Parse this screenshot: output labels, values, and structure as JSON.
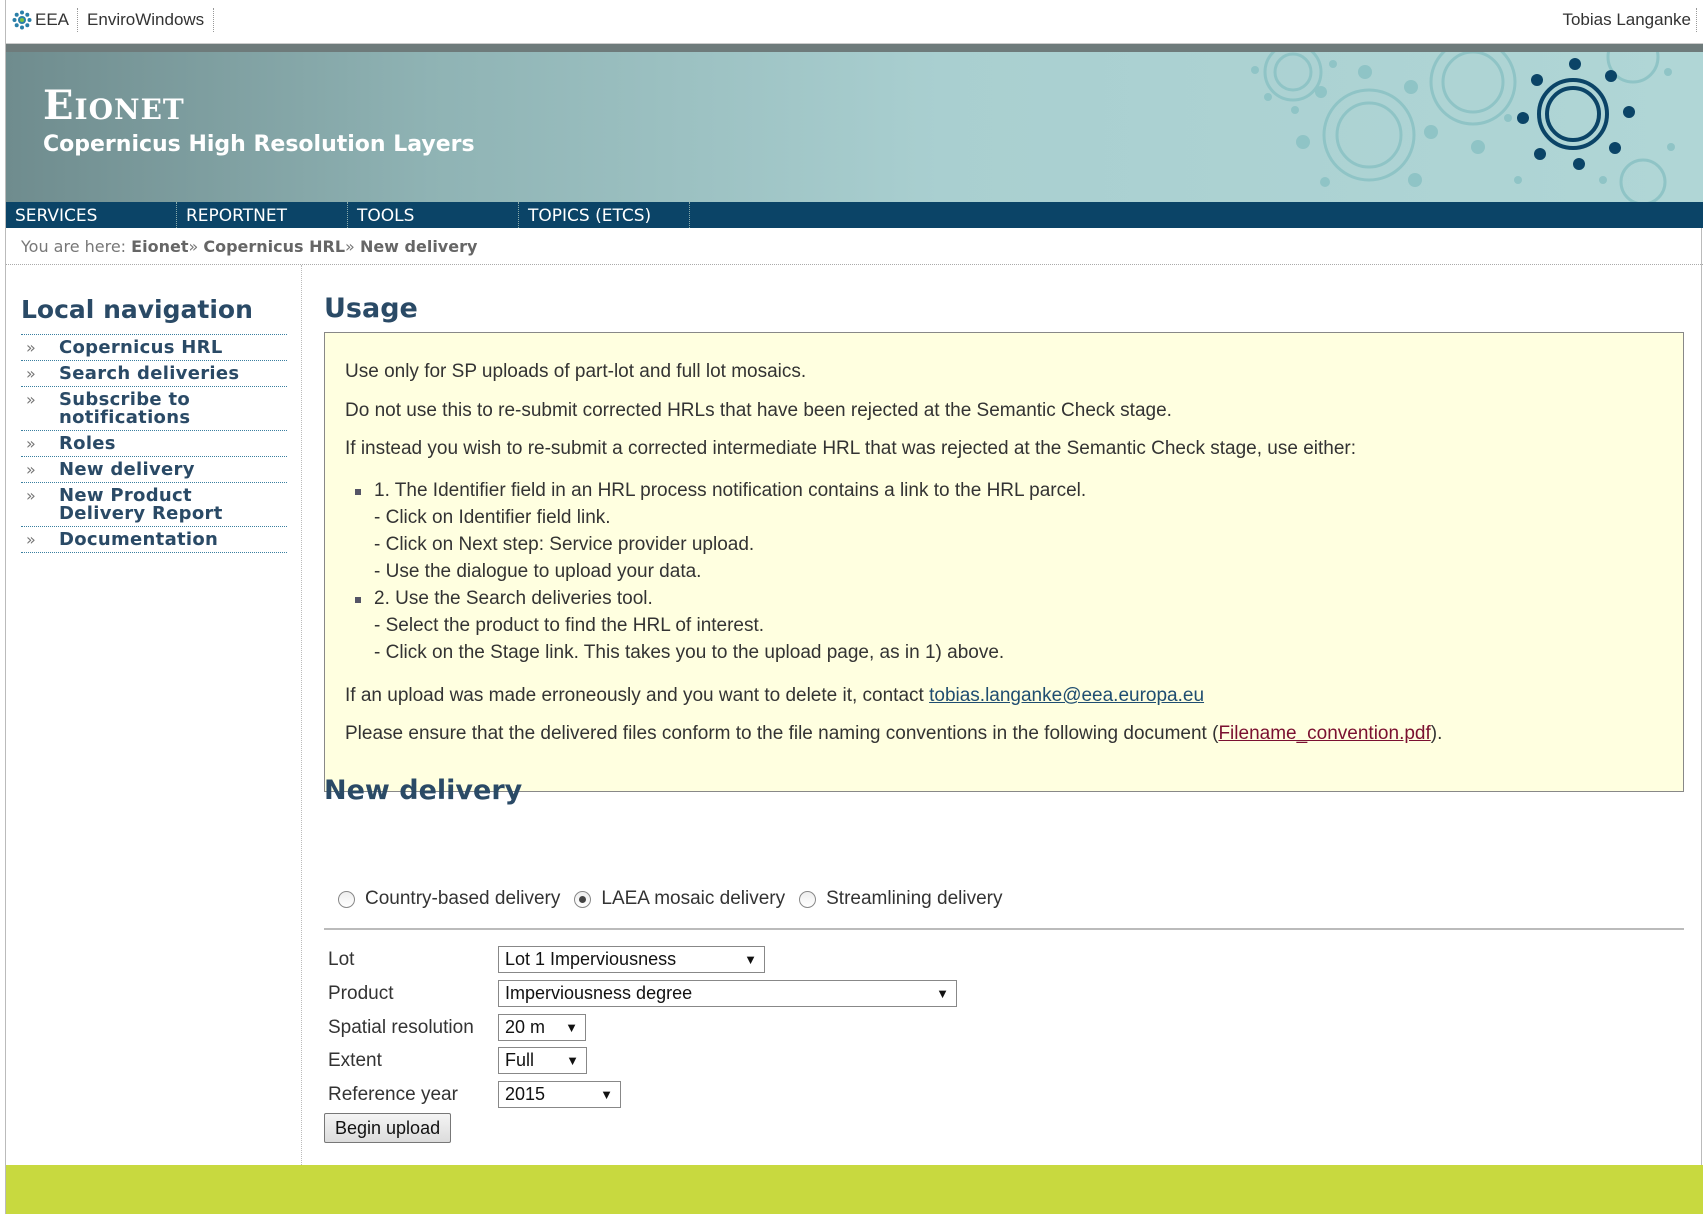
{
  "topbar": {
    "eea_label": "EEA",
    "envirowindows_label": "EnviroWindows",
    "user_name": "Tobias Langanke"
  },
  "header": {
    "site_title": "Eionet",
    "subtitle": "Copernicus High Resolution Layers"
  },
  "nav": [
    "SERVICES",
    "REPORTNET",
    "TOOLS",
    "TOPICS (ETCS)"
  ],
  "breadcrumb": {
    "prefix": "You are here:",
    "items": [
      "Eionet",
      "Copernicus HRL",
      "New delivery"
    ],
    "separator": "»"
  },
  "local_nav": {
    "title": "Local navigation",
    "items": [
      "Copernicus HRL",
      "Search deliveries",
      "Subscribe to notifications",
      "Roles",
      "New delivery",
      "New Product Delivery Report",
      "Documentation"
    ]
  },
  "usage": {
    "heading": "Usage",
    "line1": "Use only for SP uploads of part-lot and full lot mosaics.",
    "line2": "Do not use this to re-submit corrected HRLs that have been rejected at the Semantic Check stage.",
    "line3": "If instead you wish to re-submit a corrected intermediate HRL that was rejected at the Semantic Check stage, use either:",
    "item1": "1. The Identifier field in an HRL process notification contains a link to the HRL parcel.",
    "item1_steps": [
      "- Click on Identifier field link.",
      "- Click on Next step: Service provider upload.",
      "- Use the dialogue to upload your data."
    ],
    "item2": "2. Use the Search deliveries tool.",
    "item2_steps": [
      "- Select the product to find the HRL of interest.",
      "- Click on the Stage link. This takes you to the upload page, as in 1) above."
    ],
    "contact_text": "If an upload was made erroneously and you want to delete it, contact",
    "contact_email": "tobias.langanke@eea.europa.eu",
    "naming_text": "Please ensure that the delivered files conform to the file naming conventions in the following document (",
    "naming_link": "Filename_convention.pdf",
    "naming_end": ")."
  },
  "new_delivery": {
    "heading": "New delivery",
    "radios": [
      {
        "label": "Country-based delivery",
        "checked": false
      },
      {
        "label": "LAEA mosaic delivery",
        "checked": true
      },
      {
        "label": "Streamlining delivery",
        "checked": false
      }
    ],
    "fields": {
      "lot": {
        "label": "Lot",
        "value": "Lot 1 Imperviousness"
      },
      "product": {
        "label": "Product",
        "value": "Imperviousness degree"
      },
      "resolution": {
        "label": "Spatial resolution",
        "value": "20 m"
      },
      "extent": {
        "label": "Extent",
        "value": "Full"
      },
      "year": {
        "label": "Reference year",
        "value": "2015"
      }
    },
    "begin_label": "Begin upload"
  },
  "icons": {
    "dropdown": "▼",
    "local_nav_bullet": "»"
  },
  "colors": {
    "navbar": "#0b4467",
    "heading": "#2a4a66",
    "usage_bg": "#ffffe0",
    "footer": "#c8d93f"
  }
}
